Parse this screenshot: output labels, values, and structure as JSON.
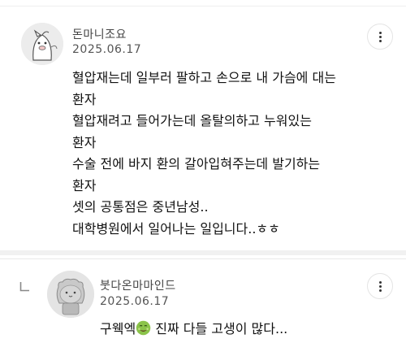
{
  "comments": [
    {
      "author": "돈마니조요",
      "date": "2025.06.17",
      "lines": [
        "혈압재는데 일부러 팔하고 손으로 내 가슴에 대는",
        "환자",
        "혈압재려고 들어가는데 올탈의하고 누워있는",
        "환자",
        "수술 전에 바지 환의 갈아입혀주는데 발기하는",
        "환자",
        "셋의 공통점은 중년남성..",
        "대학병원에서 일어나는 일입니다..ㅎㅎ"
      ],
      "more_icon": "more-vertical-icon"
    },
    {
      "author": "붓다온마마인드",
      "date": "2025.06.17",
      "text_before": "구웩엑",
      "emoji": "nauseated-face-emoji",
      "text_after": " 진짜 다들 고생이 많다...",
      "more_icon": "more-vertical-icon",
      "reply_icon": "reply-arrow-icon"
    }
  ]
}
